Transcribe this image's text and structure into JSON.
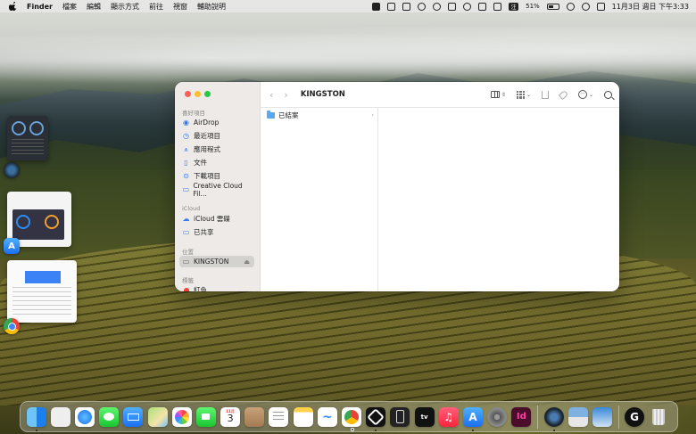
{
  "menubar": {
    "app_name": "Finder",
    "menus": [
      "檔案",
      "編輯",
      "顯示方式",
      "前往",
      "視窗",
      "輔助說明"
    ],
    "battery_percent": "51%",
    "input_method": "注",
    "clock": "11月3日 週日 下午3:33"
  },
  "finder": {
    "title": "KINGSTON",
    "sidebar": {
      "favorites_header": "喜好項目",
      "favorites": [
        {
          "label": "AirDrop",
          "icon": "airdrop-icon"
        },
        {
          "label": "最近項目",
          "icon": "clock-icon"
        },
        {
          "label": "應用程式",
          "icon": "apps-icon"
        },
        {
          "label": "文件",
          "icon": "document-icon"
        },
        {
          "label": "下載項目",
          "icon": "download-icon"
        },
        {
          "label": "Creative Cloud Fil…",
          "icon": "folder-icon"
        }
      ],
      "icloud_header": "iCloud",
      "icloud": [
        {
          "label": "iCloud 雲碟",
          "icon": "cloud-icon"
        },
        {
          "label": "已共享",
          "icon": "shared-folder-icon"
        }
      ],
      "locations_header": "位置",
      "locations": [
        {
          "label": "KINGSTON",
          "icon": "drive-icon",
          "selected": true
        }
      ],
      "tags_header": "標籤",
      "tags": [
        {
          "label": "紅色",
          "color": "#ff3b30"
        }
      ]
    },
    "column_items": [
      {
        "label": "已結案",
        "icon": "folder-icon"
      }
    ]
  },
  "calendar_dock": {
    "month": "11月",
    "day": "3"
  },
  "colors": {
    "accent": "#2f7cf6",
    "traffic_red": "#ff5f57",
    "traffic_yellow": "#febc2e",
    "traffic_green": "#28c840"
  }
}
